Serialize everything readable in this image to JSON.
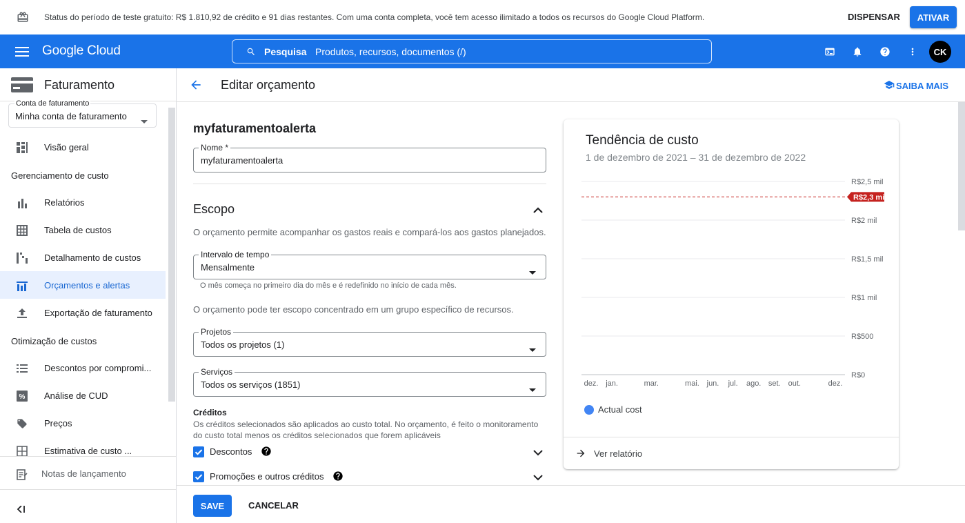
{
  "trial_banner": {
    "message": "Status do período de teste gratuito: R$ 1.810,92 de crédito e 91 dias restantes. Com uma conta completa, você tem acesso ilimitado a todos os recursos do Google Cloud Platform.",
    "dismiss_label": "DISPENSAR",
    "activate_label": "ATIVAR"
  },
  "topbar": {
    "logo": "Google Cloud",
    "search_label": "Pesquisa",
    "search_placeholder": "Produtos, recursos, documentos (/)",
    "avatar_initials": "CK",
    "icons": [
      "menu-icon",
      "terminal-icon",
      "bell-icon",
      "help-icon",
      "more-vert-icon"
    ]
  },
  "sidebar": {
    "title": "Faturamento",
    "account_label": "Conta de faturamento",
    "account_value": "Minha conta de faturamento",
    "overview": "Visão geral",
    "section_cost_mgmt": "Gerenciamento de custo",
    "items_cost_mgmt": [
      {
        "label": "Relatórios",
        "icon": "bar-chart-icon",
        "active": false
      },
      {
        "label": "Tabela de custos",
        "icon": "table-icon",
        "active": false
      },
      {
        "label": "Detalhamento de custos",
        "icon": "breakdown-icon",
        "active": false
      },
      {
        "label": "Orçamentos e alertas",
        "icon": "budget-icon",
        "active": true
      },
      {
        "label": "Exportação de faturamento",
        "icon": "export-icon",
        "active": false
      }
    ],
    "section_cost_opt": "Otimização de custos",
    "items_cost_opt": [
      {
        "label": "Descontos por compromi...",
        "icon": "list-icon"
      },
      {
        "label": "Análise de CUD",
        "icon": "percent-icon"
      },
      {
        "label": "Preços",
        "icon": "tag-icon"
      },
      {
        "label": "Estimativa de custo ...",
        "icon": "calculator-icon"
      }
    ],
    "release_notes": "Notas de lançamento"
  },
  "page": {
    "title": "Editar orçamento",
    "learn_more": "SAIBA MAIS"
  },
  "form": {
    "budget_name": "myfaturamentoalerta",
    "name_label": "Nome *",
    "name_value": "myfaturamentoalerta",
    "scope_title": "Escopo",
    "scope_desc": "O orçamento permite acompanhar os gastos reais e compará-los aos gastos planejados.",
    "time_range_label": "Intervalo de tempo",
    "time_range_value": "Mensalmente",
    "time_range_hint": "O mês começa no primeiro dia do mês e é redefinido no início de cada mês.",
    "scope_hint": "O orçamento pode ter escopo concentrado em um grupo específico de recursos.",
    "projects_label": "Projetos",
    "projects_value": "Todos os projetos (1)",
    "services_label": "Serviços",
    "services_value": "Todos os serviços (1851)",
    "credits_title": "Créditos",
    "credits_desc": "Os créditos selecionados são aplicados ao custo total. No orçamento, é feito o monitoramento do custo total menos os créditos selecionados que forem aplicáveis",
    "credit_discounts": "Descontos",
    "credit_promotions": "Promoções e outros créditos"
  },
  "actions": {
    "save": "SAVE",
    "cancel": "CANCELAR"
  },
  "card": {
    "title": "Tendência de custo",
    "subtitle": "1 de dezembro de 2021 – 31 de dezembro de 2022",
    "legend": "Actual cost",
    "view_report": "Ver relatório"
  },
  "chart_data": {
    "type": "line",
    "title": "Tendência de custo",
    "x": [
      "dez.",
      "jan.",
      "mar.",
      "mai.",
      "jun.",
      "jul.",
      "ago.",
      "set.",
      "out.",
      "dez."
    ],
    "x_positions_days": [
      0,
      31,
      90,
      151,
      182,
      212,
      243,
      274,
      304,
      365
    ],
    "y_ticks": [
      0,
      500,
      1000,
      1500,
      2000,
      2500
    ],
    "y_tick_labels": [
      "R$0",
      "R$500",
      "R$1 mil",
      "R$1,5 mil",
      "R$2 mil",
      "R$2,5 mil"
    ],
    "ylim": [
      0,
      2500
    ],
    "budget_line": {
      "value": 2300,
      "label": "R$2,3 mil",
      "color": "#c5221f"
    },
    "series": [
      {
        "name": "Actual cost",
        "color": "#4285f4",
        "values": []
      }
    ],
    "legend": "bottom-left"
  }
}
